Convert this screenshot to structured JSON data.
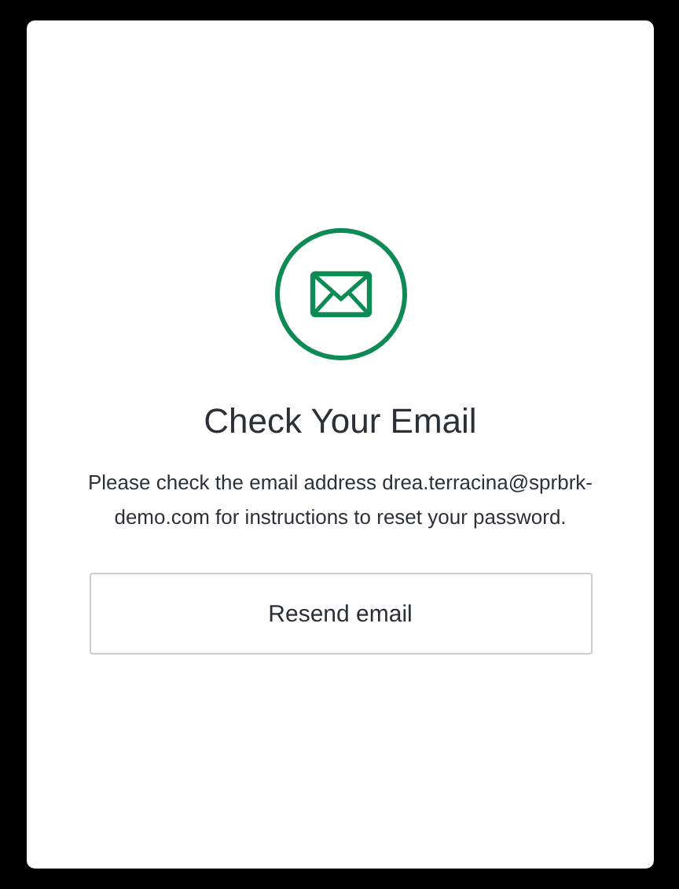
{
  "title": "Check Your Email",
  "message": "Please check the email address drea.terracina@sprbrk-demo.com for instructions to reset your password.",
  "button": "Resend email"
}
